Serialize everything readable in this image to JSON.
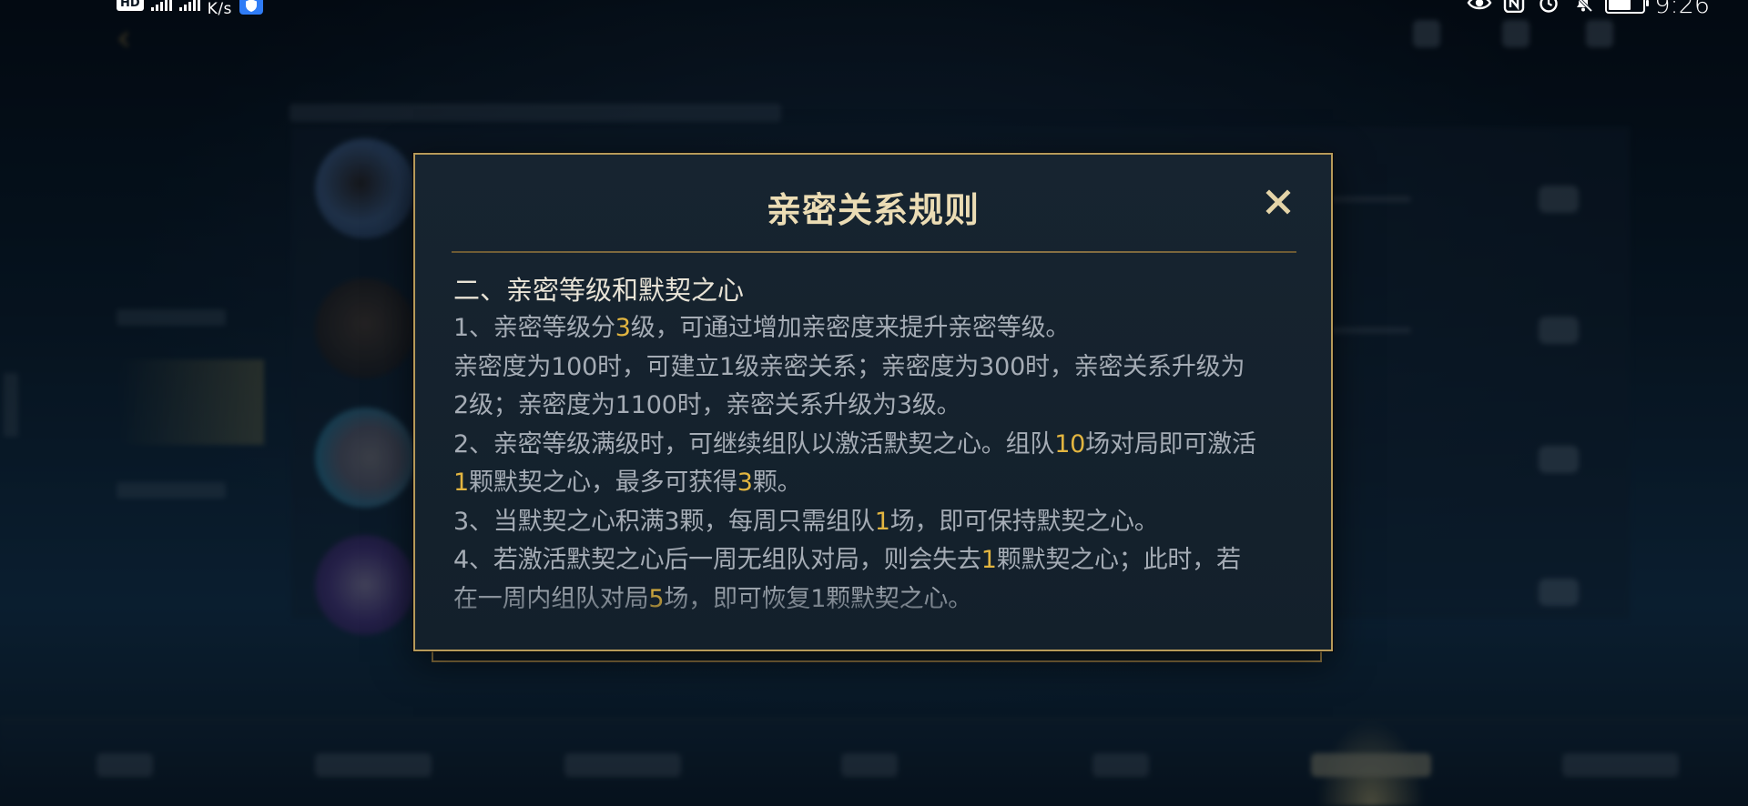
{
  "status_bar": {
    "hd": "HD",
    "network_speed": "K/s",
    "time": "9:26"
  },
  "modal": {
    "title": "亲密关系规则",
    "section_heading": "二、亲密等级和默契之心",
    "lines": [
      [
        {
          "t": "1、亲密等级分"
        },
        {
          "t": "3",
          "hl": true
        },
        {
          "t": "级，可通过增加亲密度来提升亲密等级。"
        }
      ],
      [
        {
          "t": "亲密度为100时，可建立1级亲密关系；亲密度为300时，亲密关系升级为"
        }
      ],
      [
        {
          "t": "2级；亲密度为1100时，亲密关系升级为3级。"
        }
      ],
      [
        {
          "t": "2、亲密等级满级时，可继续组队以激活默契之心。组队"
        },
        {
          "t": "10",
          "hl": true
        },
        {
          "t": "场对局即可激活"
        }
      ],
      [
        {
          "t": "1",
          "hl": true
        },
        {
          "t": "颗默契之心，最多可获得"
        },
        {
          "t": "3",
          "hl": true
        },
        {
          "t": "颗。"
        }
      ],
      [
        {
          "t": "3、当默契之心积满3颗，每周只需组队"
        },
        {
          "t": "1",
          "hl": true
        },
        {
          "t": "场，即可保持默契之心。"
        }
      ],
      [
        {
          "t": "4、若激活默契之心后一周无组队对局，则会失去"
        },
        {
          "t": "1",
          "hl": true
        },
        {
          "t": "颗默契之心；此时，若"
        }
      ],
      [
        {
          "t": "在一周内组队对局"
        },
        {
          "t": "5",
          "hl": true
        },
        {
          "t": "场，即可恢复1颗默契之心。"
        }
      ]
    ]
  },
  "colors": {
    "accent_gold": "#e2b540",
    "modal_border": "#b79a5a",
    "title_color": "#ebdcb4",
    "body_text": "#a5acb5"
  },
  "icons": {
    "close": "close-icon",
    "battery": "battery-icon",
    "eye": "eye-icon",
    "nfc": "nfc-icon",
    "alarm": "alarm-icon",
    "bell": "bell-muted-icon"
  }
}
